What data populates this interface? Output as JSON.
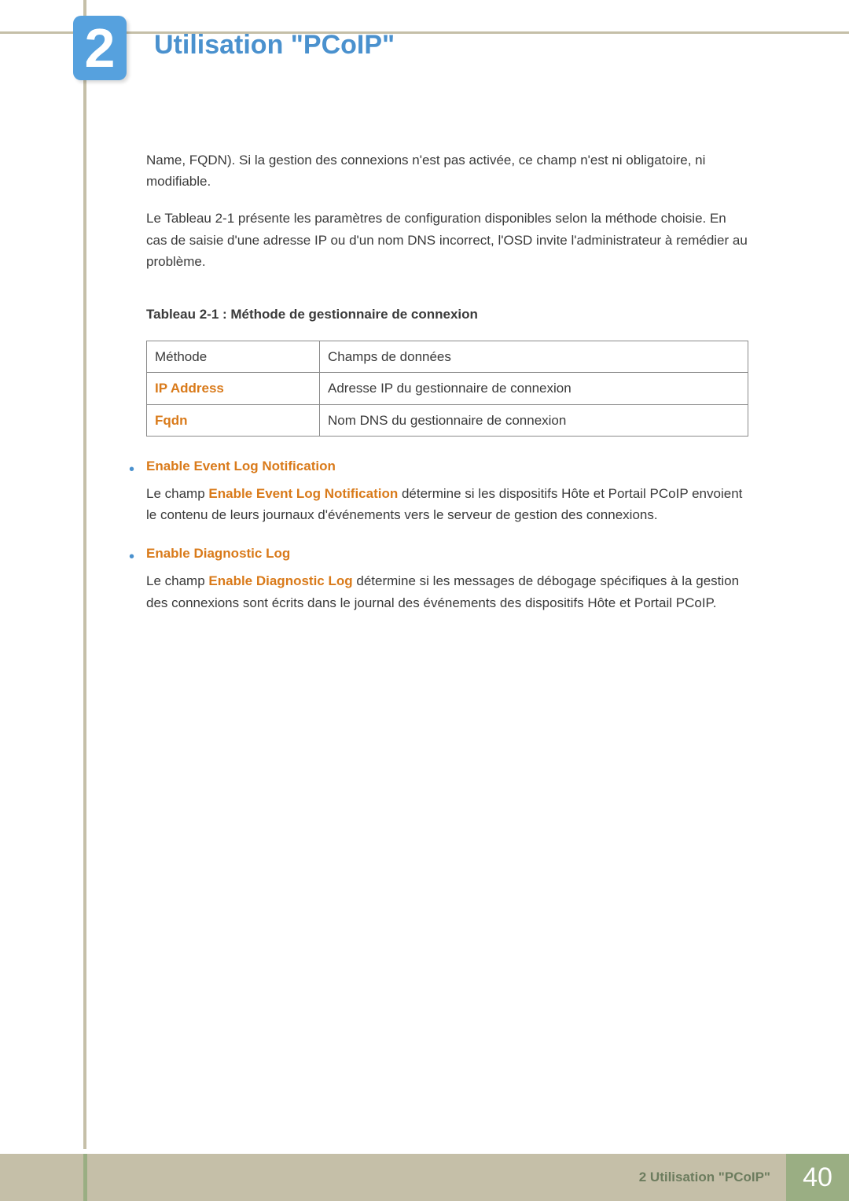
{
  "chapter": {
    "number": "2",
    "title": "Utilisation \"PCoIP\""
  },
  "paragraphs": {
    "p1": "Name, FQDN). Si la gestion des connexions n'est pas activée, ce champ n'est ni obligatoire, ni modifiable.",
    "p2": "Le Tableau 2-1 présente les paramètres de configuration disponibles selon la méthode choisie. En cas de saisie d'une adresse IP ou d'un nom DNS incorrect, l'OSD invite l'administrateur à remédier au problème."
  },
  "table": {
    "caption": "Tableau 2-1 : Méthode de gestionnaire de connexion",
    "header": {
      "c1": "Méthode",
      "c2": "Champs de données"
    },
    "rows": [
      {
        "c1": "IP Address",
        "c2": "Adresse IP du gestionnaire de connexion"
      },
      {
        "c1": "Fqdn",
        "c2": "Nom DNS du gestionnaire de connexion"
      }
    ]
  },
  "bullets": [
    {
      "head": "Enable Event Log Notification",
      "pre": "Le champ ",
      "term": "Enable Event Log Notification",
      "post": " détermine si les dispositifs Hôte et Portail PCoIP envoient le contenu de leurs journaux d'événements vers le serveur de gestion des connexions."
    },
    {
      "head": "Enable Diagnostic Log",
      "pre": "Le champ ",
      "term": "Enable Diagnostic Log",
      "post": " détermine si les messages de débogage spécifiques à la gestion des connexions sont écrits dans le journal des événements des dispositifs Hôte et Portail PCoIP."
    }
  ],
  "footer": {
    "label": "2 Utilisation \"PCoIP\"",
    "page": "40"
  }
}
